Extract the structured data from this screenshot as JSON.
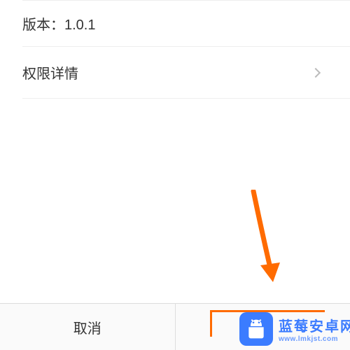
{
  "info": {
    "version_label": "版本：1.0.1"
  },
  "nav": {
    "permissions_label": "权限详情"
  },
  "buttons": {
    "cancel": "取消",
    "confirm": ""
  },
  "watermark": {
    "title": "蓝莓安卓网",
    "subtitle": "www.lmkjst.com"
  },
  "annotation": {
    "arrow_color": "#ff6b00"
  }
}
